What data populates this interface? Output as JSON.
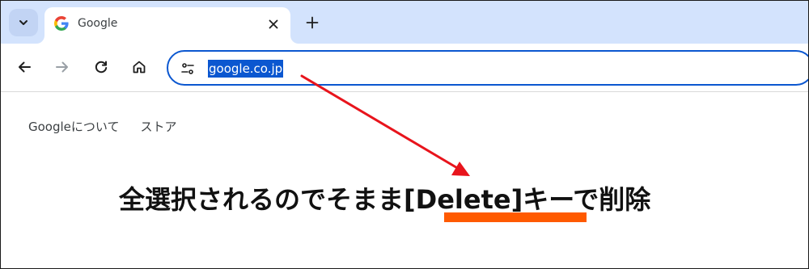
{
  "tab": {
    "title": "Google",
    "favicon": "google-g-icon"
  },
  "toolbar": {
    "url": "google.co.jp",
    "icons": [
      "back-arrow-icon",
      "forward-arrow-icon",
      "reload-icon",
      "home-icon",
      "site-info-icon"
    ]
  },
  "page": {
    "links": [
      "Googleについて",
      "ストア"
    ]
  },
  "annotation": {
    "text": "全選択されるのでそまま[Delete]キーで削除"
  },
  "colors": {
    "tabstrip": "#d3e3fd",
    "omnibox_border": "#0b57d0",
    "selection": "#0b57d0",
    "arrow": "#e8141c",
    "underline": "#ff5a00"
  }
}
